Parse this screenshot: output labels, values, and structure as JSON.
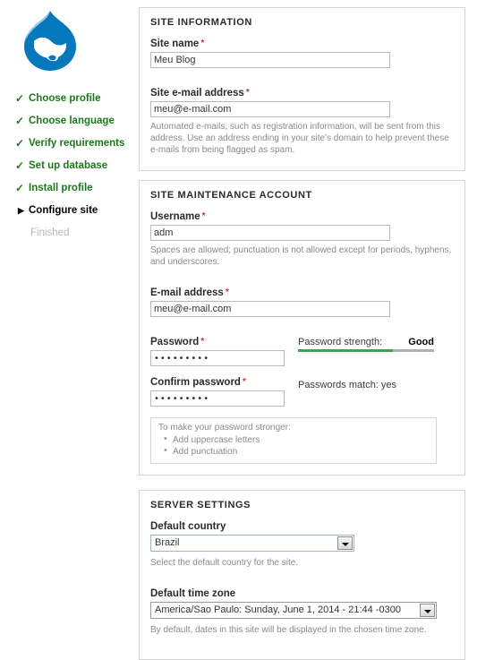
{
  "brand": {
    "logo_icon": "drupal-droplet-logo",
    "logo_color": "#0678be",
    "logo_color_dark": "#04598c"
  },
  "colors": {
    "done_green": "#1a7a1a",
    "strength_green": "#3fa34a",
    "required_red": "#c0392b",
    "pending_gray": "#b8b8b8"
  },
  "sidebar": {
    "items": [
      {
        "label": "Choose profile",
        "state": "done",
        "icon": "check-icon"
      },
      {
        "label": "Choose language",
        "state": "done",
        "icon": "check-icon"
      },
      {
        "label": "Verify requirements",
        "state": "done",
        "icon": "check-icon"
      },
      {
        "label": "Set up database",
        "state": "done",
        "icon": "check-icon"
      },
      {
        "label": "Install profile",
        "state": "done",
        "icon": "check-icon"
      },
      {
        "label": "Configure site",
        "state": "active",
        "icon": "triangle-right-icon"
      },
      {
        "label": "Finished",
        "state": "pending",
        "icon": "none"
      }
    ]
  },
  "site_information": {
    "title": "SITE INFORMATION",
    "site_name": {
      "label": "Site name",
      "required_marker": "*",
      "value": "Meu Blog",
      "placeholder": ""
    },
    "site_email": {
      "label": "Site e-mail address",
      "required_marker": "*",
      "value": "meu@e-mail.com",
      "placeholder": "",
      "description": "Automated e-mails, such as registration information, will be sent from this address. Use an address ending in your site's domain to help prevent these e-mails from being flagged as spam."
    }
  },
  "maintenance_account": {
    "title": "SITE MAINTENANCE ACCOUNT",
    "username": {
      "label": "Username",
      "required_marker": "*",
      "value": "adm",
      "placeholder": "",
      "description": "Spaces are allowed; punctuation is not allowed except for periods, hyphens, and underscores."
    },
    "email": {
      "label": "E-mail address",
      "required_marker": "*",
      "value": "meu@e-mail.com",
      "placeholder": ""
    },
    "password": {
      "label": "Password",
      "required_marker": "*",
      "value": "•••••••••",
      "strength_label": "Password strength:",
      "strength_word": "Good",
      "strength_percent": 70
    },
    "confirm_password": {
      "label": "Confirm password",
      "required_marker": "*",
      "value": "•••••••••",
      "match_text": "Passwords match: yes"
    },
    "hints": {
      "title": "To make your password stronger:",
      "items": [
        "Add uppercase letters",
        "Add punctuation"
      ]
    }
  },
  "server_settings": {
    "title": "SERVER SETTINGS",
    "default_country": {
      "label": "Default country",
      "value": "Brazil",
      "description": "Select the default country for the site.",
      "dropdown_icon": "chevron-down-icon"
    },
    "default_time_zone": {
      "label": "Default time zone",
      "value": "America/Sao Paulo: Sunday, June 1, 2014 - 21:44 -0300",
      "description": "By default, dates in this site will be displayed in the chosen time zone.",
      "dropdown_icon": "chevron-down-icon"
    }
  }
}
